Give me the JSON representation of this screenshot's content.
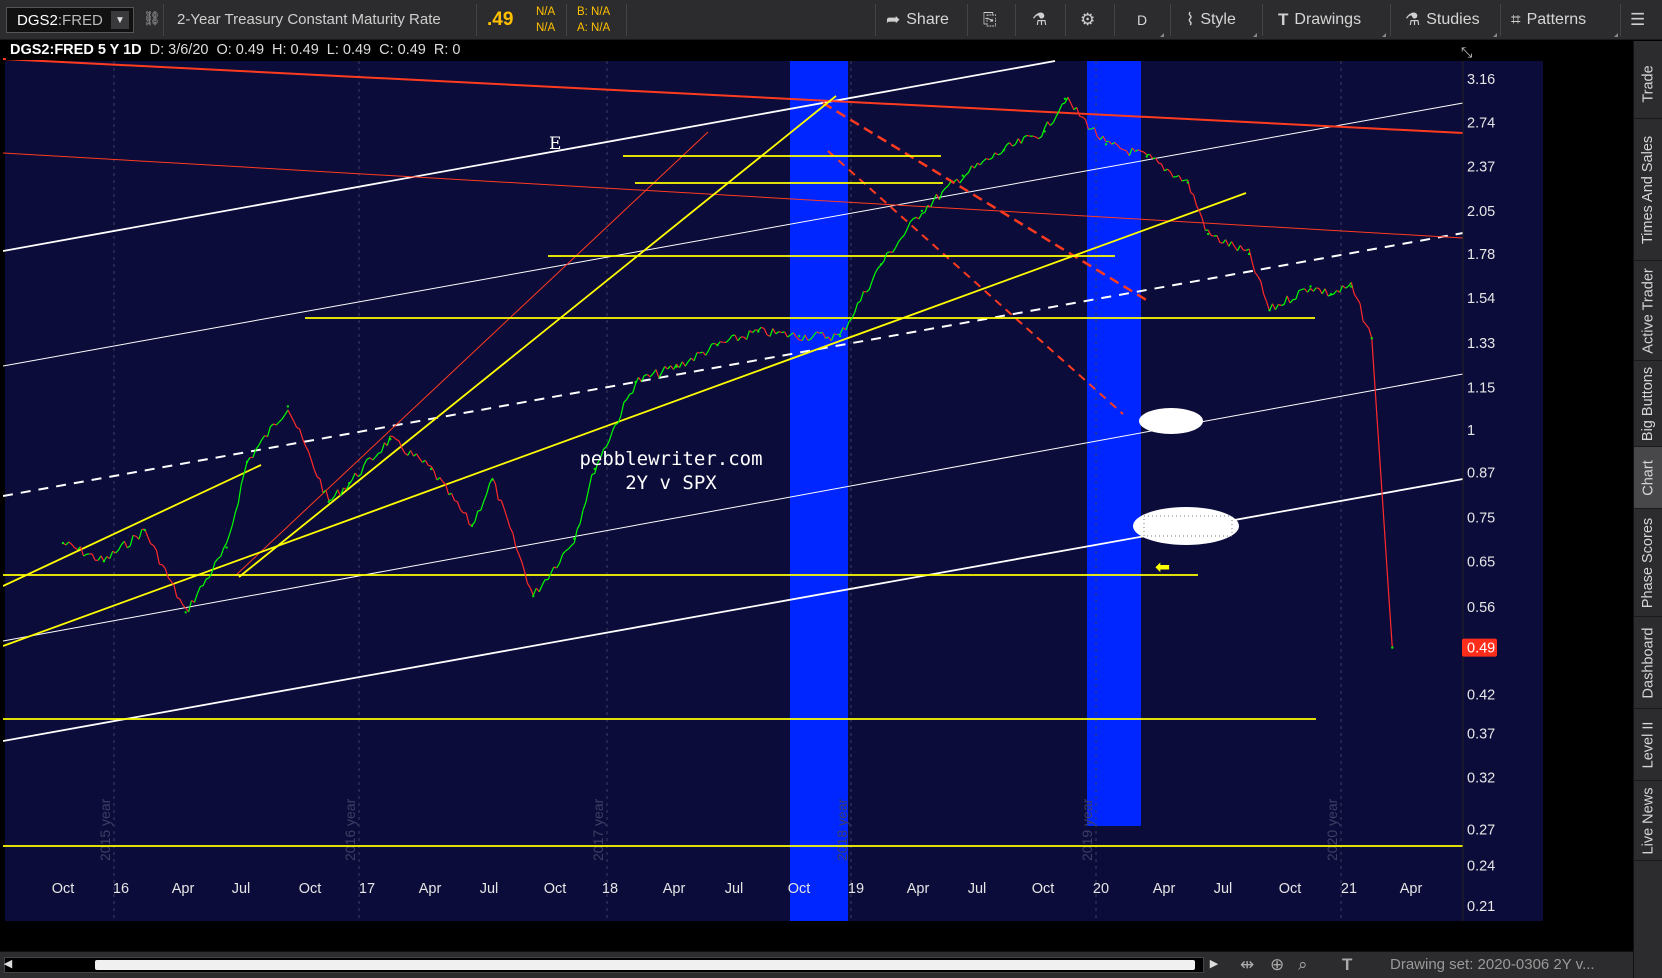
{
  "toolbar": {
    "symbol": "DGS2",
    "symbol_source": ":FRED",
    "description": "2-Year Treasury Constant Maturity Rate",
    "last": ".49",
    "na_top": "N/A",
    "na_bottom": "N/A",
    "bid": "B: N/A",
    "ask": "A: N/A",
    "share": "Share",
    "aggregation": "D",
    "style": "Style",
    "drawings": "Drawings",
    "studies": "Studies",
    "patterns": "Patterns"
  },
  "info_bar": {
    "symbol": "DGS2:FRED 5 Y 1D",
    "date": "D: 3/6/20",
    "open": "O: 0.49",
    "high": "H: 0.49",
    "low": "L: 0.49",
    "close": "C: 0.49",
    "range": "R: 0"
  },
  "annotations": {
    "watermark_line1": "pebblewriter.com",
    "watermark_line2": "2Y v SPX",
    "label_e": "E"
  },
  "sidebar": {
    "tabs": [
      "Trade",
      "Times And Sales",
      "Active Trader",
      "Big Buttons",
      "Chart",
      "Phase Scores",
      "Dashboard",
      "Level II",
      "Live News"
    ],
    "active": "Chart"
  },
  "bottom": {
    "drawing_set": "Drawing set: 2020-0306 2Y v..."
  },
  "colors": {
    "plot_bg": "#0c0c3a",
    "recession_band": "#0026ff",
    "trend_yellow": "#ffff00",
    "trend_red": "#ff3b1f",
    "trend_white": "#ffffff",
    "last_price_tag": "#ff2d1a",
    "up_bar": "#00ff00",
    "down_bar": "#ff2a2a"
  },
  "chart_data": {
    "type": "line",
    "scale": "log",
    "ylim": [
      0.2,
      3.35
    ],
    "y_ticks": [
      "3.16",
      "2.74",
      "2.37",
      "2.05",
      "1.78",
      "1.54",
      "1.33",
      "1.15",
      "1",
      "0.87",
      "0.75",
      "0.65",
      "0.56",
      "0.49",
      "0.42",
      "0.37",
      "0.32",
      "0.27",
      "0.24",
      "0.21"
    ],
    "x_labels": [
      "Oct",
      "16",
      "Apr",
      "Jul",
      "Oct",
      "17",
      "Apr",
      "Jul",
      "Oct",
      "18",
      "Apr",
      "Jul",
      "Oct",
      "19",
      "Apr",
      "Jul",
      "Oct",
      "20",
      "Apr",
      "Jul",
      "Oct",
      "21",
      "Apr"
    ],
    "year_labels": [
      "2015 year",
      "2016 year",
      "2017 year",
      "2018 year",
      "2019 year",
      "2020 year"
    ],
    "last_value_label": "0.49",
    "x": [
      "2014-10",
      "2014-12",
      "2015-02",
      "2015-04",
      "2015-06",
      "2015-07",
      "2015-09",
      "2015-11",
      "2015-12",
      "2016-02",
      "2016-04",
      "2016-06",
      "2016-07",
      "2016-09",
      "2016-11",
      "2016-12",
      "2017-02",
      "2017-04",
      "2017-06",
      "2017-08",
      "2017-10",
      "2017-12",
      "2018-02",
      "2018-04",
      "2018-06",
      "2018-08",
      "2018-10",
      "2018-11",
      "2019-01",
      "2019-03",
      "2019-05",
      "2019-06",
      "2019-08",
      "2019-09",
      "2019-11",
      "2019-12",
      "2020-01",
      "2020-02",
      "2020-03"
    ],
    "values": [
      0.69,
      0.65,
      0.72,
      0.55,
      0.68,
      0.9,
      1.08,
      0.79,
      0.84,
      0.97,
      0.88,
      0.73,
      0.85,
      0.58,
      0.7,
      0.88,
      1.17,
      1.23,
      1.32,
      1.38,
      1.36,
      1.36,
      1.72,
      2.05,
      2.3,
      2.5,
      2.66,
      2.96,
      2.55,
      2.45,
      2.25,
      1.9,
      1.78,
      1.48,
      1.6,
      1.56,
      1.6,
      1.35,
      0.49
    ]
  }
}
